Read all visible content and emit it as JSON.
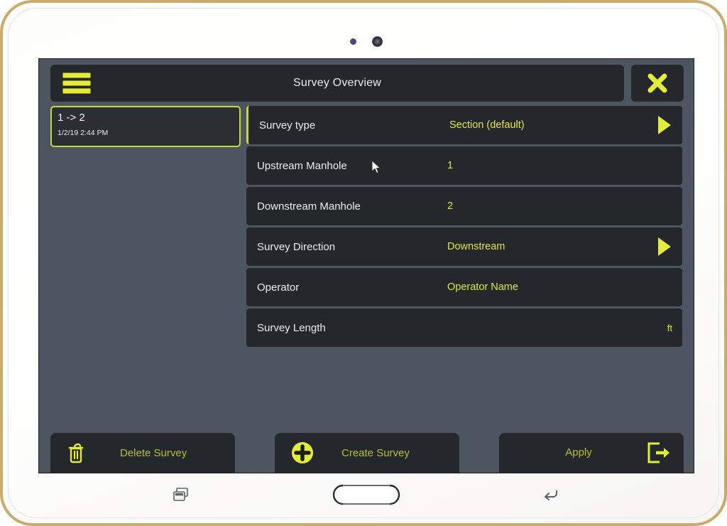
{
  "device": {
    "sensors": [
      "proximity-sensor",
      "front-camera"
    ],
    "frame_color": "#c9ab6b",
    "body_color": "#ffffff"
  },
  "app": {
    "accent_color": "#e0e83f",
    "panel_color": "#24272c",
    "background_color": "#4d5560",
    "header": {
      "menu_icon": "hamburger-menu-icon",
      "title": "Survey Overview",
      "close_icon": "close-x-icon"
    },
    "sidebar": {
      "items": [
        {
          "name": "1 -> 2",
          "timestamp": "1/2/19 2:44 PM",
          "selected": true
        }
      ]
    },
    "form": {
      "rows": [
        {
          "label": "Survey type",
          "value": "Section (default)",
          "unit": "",
          "has_arrow": true,
          "highlighted": true
        },
        {
          "label": "Upstream Manhole",
          "value": "1",
          "unit": "",
          "has_arrow": false,
          "highlighted": false
        },
        {
          "label": "Downstream Manhole",
          "value": "2",
          "unit": "",
          "has_arrow": false,
          "highlighted": false
        },
        {
          "label": "Survey Direction",
          "value": "Downstream",
          "unit": "",
          "has_arrow": true,
          "highlighted": false
        },
        {
          "label": "Operator",
          "value": "Operator Name",
          "unit": "",
          "has_arrow": false,
          "highlighted": false
        },
        {
          "label": "Survey Length",
          "value": "",
          "unit": "ft",
          "has_arrow": false,
          "highlighted": false
        }
      ]
    },
    "toolbar": {
      "delete_label": "Delete Survey",
      "delete_icon": "trash-icon",
      "create_label": "Create Survey",
      "create_icon": "plus-circle-icon",
      "apply_label": "Apply",
      "apply_icon": "exit-arrow-icon"
    }
  },
  "system_nav": {
    "recents_icon": "recents-icon",
    "home_icon": "home-icon",
    "back_icon": "back-icon"
  }
}
